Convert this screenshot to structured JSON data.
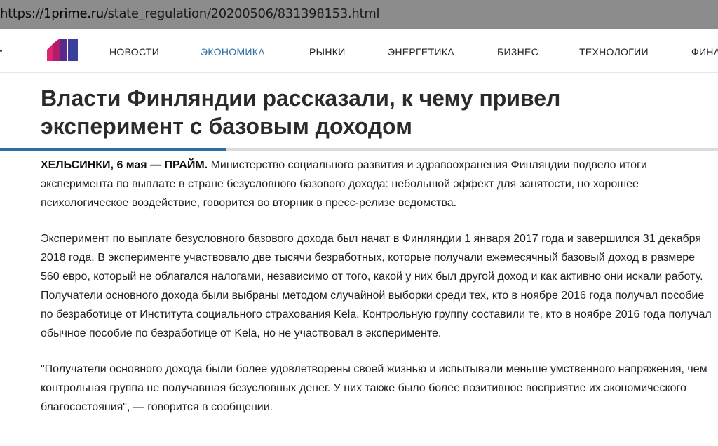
{
  "browser": {
    "url_scheme": "https://",
    "url_domain": "1prime.ru",
    "url_path": "/state_regulation/20200506/831398153.html"
  },
  "nav": {
    "logo": "site-logo",
    "items": [
      {
        "label": "НОВОСТИ",
        "active": false
      },
      {
        "label": "ЭКОНОМИКА",
        "active": true
      },
      {
        "label": "РЫНКИ",
        "active": false
      },
      {
        "label": "ЭНЕРГЕТИКА",
        "active": false
      },
      {
        "label": "БИЗНЕС",
        "active": false
      },
      {
        "label": "ТЕХНОЛОГИИ",
        "active": false
      },
      {
        "label": "ФИНА",
        "active": false
      }
    ]
  },
  "article": {
    "title": "Власти Финляндии рассказали, к чему привел эксперимент с базовым доходом",
    "read_progress": 0.315,
    "dateline": "ХЕЛЬСИНКИ, 6 мая — ПРАЙМ.",
    "lead": " Министерство социального развития и здравоохранения Финляндии подвело итоги эксперимента по выплате в стране безусловного базового дохода: небольшой эффект для занятости, но хорошее психологическое воздействие, говорится во вторник в пресс-релизе ведомства.",
    "paragraph_2": "Эксперимент по выплате безусловного базового дохода был начат в Финляндии 1 января 2017 года и завершился 31 декабря 2018 года. В эксперименте участвовало две тысячи безработных, которые получали ежемесячный базовый доход в размере 560 евро, который не облагался налогами, независимо от того, какой у них был другой доход и как активно они искали работу. Получатели основного дохода были выбраны методом случайной выборки среди тех, кто в ноябре 2016 года получал пособие по безработице от Института социального страхования Kela. Контрольную группу составили те, кто в ноябре 2016 года получал обычное пособие по безработице от Kela, но не участвовал в эксперименте.",
    "paragraph_3": "\"Получатели основного дохода были более удовлетворены своей жизнью и испытывали меньше умственного напряжения, чем контрольная группа не получавшая безусловных денег. У них также было более позитивное восприятие их экономического благосостояния\", — говорится в сообщении."
  },
  "colors": {
    "accent": "#2d6ea3",
    "url_bar": "#8c8c8c",
    "headline": "#2b2b2b"
  }
}
